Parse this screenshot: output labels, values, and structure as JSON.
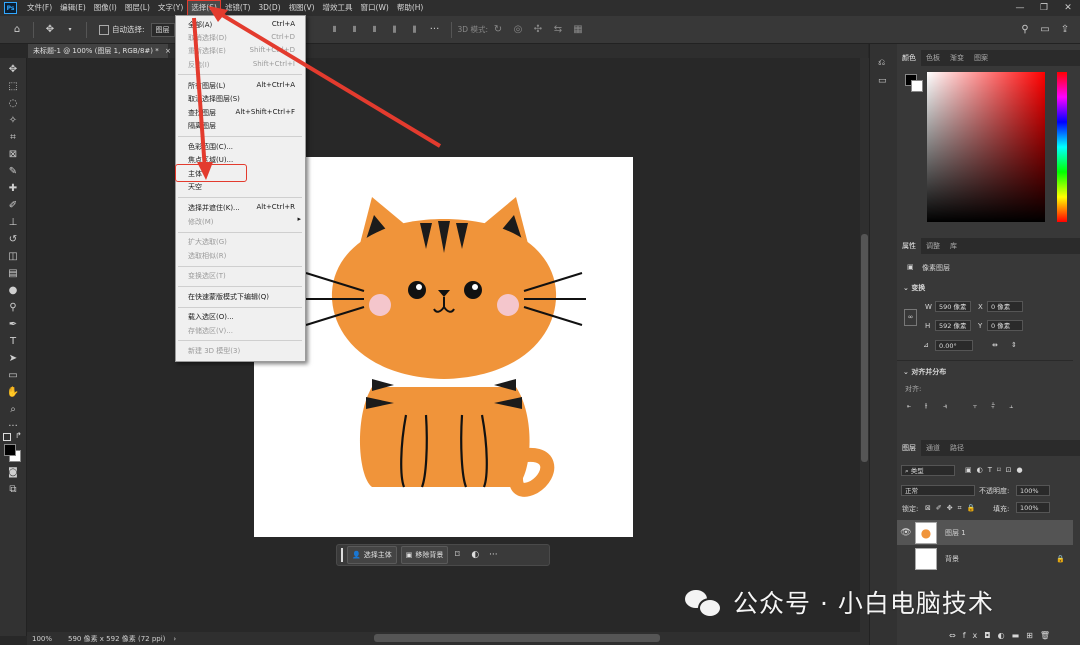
{
  "app": {
    "logo_text": "Ps"
  },
  "menubar": {
    "items": [
      "文件(F)",
      "编辑(E)",
      "图像(I)",
      "图层(L)",
      "文字(Y)",
      "选择(S)",
      "滤镜(T)",
      "3D(D)",
      "视图(V)",
      "增效工具",
      "窗口(W)",
      "帮助(H)"
    ],
    "active_index": 5
  },
  "options_bar": {
    "auto_select_label": "自动选择:",
    "auto_select_value": "图层",
    "mode_3d_label": "3D 模式:"
  },
  "document_tab": {
    "title": "未标题-1 @ 100% (图层 1, RGB/8#) *"
  },
  "select_menu": {
    "items": [
      {
        "label": "全部(A)",
        "shortcut": "Ctrl+A",
        "disabled": false
      },
      {
        "label": "取消选择(D)",
        "shortcut": "Ctrl+D",
        "disabled": true
      },
      {
        "label": "重新选择(E)",
        "shortcut": "Shift+Ctrl+D",
        "disabled": true
      },
      {
        "label": "反选(I)",
        "shortcut": "Shift+Ctrl+I",
        "disabled": true
      },
      {
        "label": "所有图层(L)",
        "shortcut": "Alt+Ctrl+A",
        "disabled": false
      },
      {
        "label": "取消选择图层(S)",
        "shortcut": "",
        "disabled": false
      },
      {
        "label": "查找图层",
        "shortcut": "Alt+Shift+Ctrl+F",
        "disabled": false
      },
      {
        "label": "隔离图层",
        "shortcut": "",
        "disabled": false
      },
      {
        "label": "色彩范围(C)...",
        "shortcut": "",
        "disabled": false
      },
      {
        "label": "焦点区域(U)...",
        "shortcut": "",
        "disabled": false
      },
      {
        "label": "主体",
        "shortcut": "",
        "disabled": false
      },
      {
        "label": "天空",
        "shortcut": "",
        "disabled": false
      },
      {
        "label": "选择并遮住(K)...",
        "shortcut": "Alt+Ctrl+R",
        "disabled": false
      },
      {
        "label": "修改(M)",
        "shortcut": "",
        "disabled": true
      },
      {
        "label": "扩大选取(G)",
        "shortcut": "",
        "disabled": true
      },
      {
        "label": "选取相似(R)",
        "shortcut": "",
        "disabled": true
      },
      {
        "label": "变换选区(T)",
        "shortcut": "",
        "disabled": true
      },
      {
        "label": "在快速蒙版模式下编辑(Q)",
        "shortcut": "",
        "disabled": false
      },
      {
        "label": "载入选区(O)...",
        "shortcut": "",
        "disabled": false
      },
      {
        "label": "存储选区(V)...",
        "shortcut": "",
        "disabled": true
      },
      {
        "label": "新建 3D 模型(3)",
        "shortcut": "",
        "disabled": true
      }
    ]
  },
  "context_bar": {
    "select_subject": "选择主体",
    "remove_bg": "移除背景"
  },
  "status_bar": {
    "zoom": "100%",
    "doc_info": "590 像素 x 592 像素 (72 ppi)"
  },
  "color_panel": {
    "tabs": [
      "颜色",
      "色板",
      "渐变",
      "图案"
    ]
  },
  "properties_panel": {
    "tabs": [
      "属性",
      "调整",
      "库"
    ],
    "type_label": "像素图层",
    "transform_title": "变换",
    "w_label": "W",
    "w_value": "590 像素",
    "h_label": "H",
    "h_value": "592 像素",
    "x_label": "X",
    "x_value": "0 像素",
    "y_label": "Y",
    "y_value": "0 像素",
    "angle_value": "0.00°",
    "align_title": "对齐并分布",
    "align_label": "对齐:"
  },
  "layers_panel": {
    "tabs": [
      "图层",
      "通道",
      "路径"
    ],
    "filter_label": "类型",
    "blend_mode": "正常",
    "opacity_label": "不透明度:",
    "opacity_value": "100%",
    "lock_label": "锁定:",
    "fill_label": "填充:",
    "fill_value": "100%",
    "layers": [
      {
        "name": "图层 1",
        "selected": true
      },
      {
        "name": "背景",
        "selected": false
      }
    ]
  },
  "watermark": {
    "text": "公众号 · 小白电脑技术"
  },
  "colors": {
    "accent_red": "#e33b2e",
    "cat_orange": "#f0943a"
  }
}
